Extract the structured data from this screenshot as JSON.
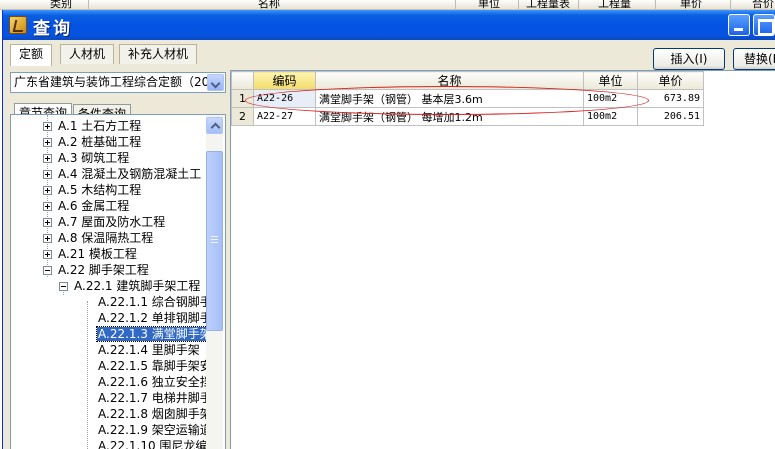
{
  "background_header": {
    "col_category": "类别",
    "col_name": "名称",
    "col_unit": "单位",
    "col_qty_expr": "工程量表",
    "col_qty": "工程量",
    "col_price": "单价",
    "col_total": "合价"
  },
  "dialog": {
    "title": "查询",
    "tabs": [
      {
        "label": "定额",
        "active": true
      },
      {
        "label": "人材机"
      },
      {
        "label": "补充人材机"
      }
    ],
    "insert_button": "插入(I)",
    "replace_button": "替换(R",
    "quota_library": "广东省建筑与装饰工程综合定额（2010",
    "search_tabs": [
      {
        "label": "章节查询",
        "active": true
      },
      {
        "label": "条件查询"
      }
    ],
    "tree": [
      {
        "label": "A.1 土石方工程",
        "level": 1,
        "expand": "plus"
      },
      {
        "label": "A.2 桩基础工程",
        "level": 1,
        "expand": "plus"
      },
      {
        "label": "A.3 砌筑工程",
        "level": 1,
        "expand": "plus"
      },
      {
        "label": "A.4 混凝土及钢筋混凝土工",
        "level": 1,
        "expand": "plus"
      },
      {
        "label": "A.5 木结构工程",
        "level": 1,
        "expand": "plus"
      },
      {
        "label": "A.6 金属工程",
        "level": 1,
        "expand": "plus"
      },
      {
        "label": "A.7 屋面及防水工程",
        "level": 1,
        "expand": "plus"
      },
      {
        "label": "A.8 保温隔热工程",
        "level": 1,
        "expand": "plus"
      },
      {
        "label": "A.21 模板工程",
        "level": 1,
        "expand": "plus"
      },
      {
        "label": "A.22 脚手架工程",
        "level": 1,
        "expand": "minus"
      },
      {
        "label": "A.22.1 建筑脚手架工程",
        "level": 2,
        "expand": "minus"
      },
      {
        "label": "A.22.1.1 综合钢脚手",
        "level": 3
      },
      {
        "label": "A.22.1.2 单排钢脚手",
        "level": 3
      },
      {
        "label": "A.22.1.3 满堂脚手架",
        "level": 3,
        "selected": true
      },
      {
        "label": "A.22.1.4 里脚手架",
        "level": 3
      },
      {
        "label": "A.22.1.5 靠脚手架安",
        "level": 3
      },
      {
        "label": "A.22.1.6 独立安全挡",
        "level": 3
      },
      {
        "label": "A.22.1.7 电梯井脚手",
        "level": 3
      },
      {
        "label": "A.22.1.8 烟囱脚手架",
        "level": 3
      },
      {
        "label": "A.22.1.9 架空运输道",
        "level": 3
      },
      {
        "label": "A.22.1.10 围尼龙编",
        "level": 3
      }
    ],
    "grid": {
      "headers": {
        "code": "编码",
        "name": "名称",
        "unit": "单位",
        "price": "单价"
      },
      "rows": [
        {
          "num": "1",
          "code": "A22-26",
          "name": "满堂脚手架（钢管） 基本层3.6m",
          "unit": "100m2",
          "price": "673.89"
        },
        {
          "num": "2",
          "code": "A22-27",
          "name": "满堂脚手架（钢管） 每增加1.2m",
          "unit": "100m2",
          "price": "206.51"
        }
      ]
    }
  },
  "colors": {
    "titlebar": "#0553e3",
    "selection": "#316ac5",
    "annotation": "#d62020",
    "header_highlight": "#f3dc68"
  }
}
